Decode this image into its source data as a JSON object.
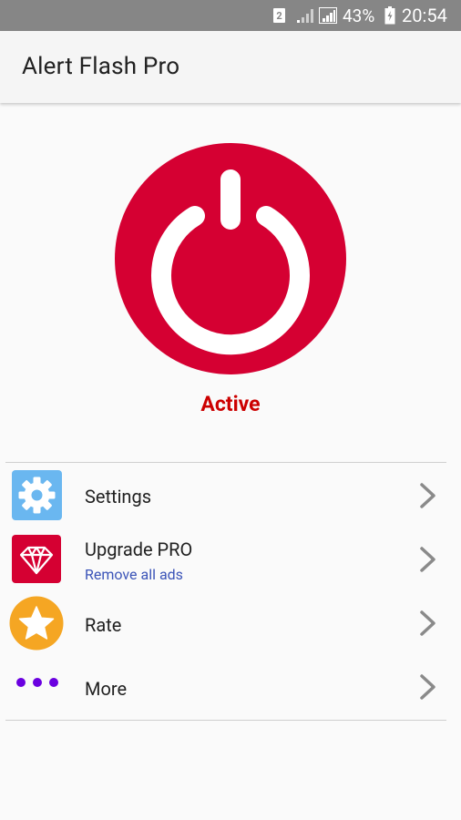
{
  "status_bar": {
    "sim_label": "2",
    "battery_percent": "43%",
    "time": "20:54"
  },
  "app_bar": {
    "title": "Alert Flash Pro"
  },
  "power": {
    "status": "Active",
    "color": "#d50032",
    "status_color": "#cc0000"
  },
  "menu": {
    "settings": {
      "label": "Settings",
      "icon": "gear-icon"
    },
    "upgrade": {
      "label": "Upgrade PRO",
      "sublabel": "Remove all ads",
      "icon": "diamond-icon"
    },
    "rate": {
      "label": "Rate",
      "icon": "star-icon"
    },
    "more": {
      "label": "More",
      "icon": "dots-icon"
    }
  },
  "colors": {
    "settings_icon_bg": "#6ab7f0",
    "upgrade_icon_bg": "#d50032",
    "rate_icon_bg": "#f5a623",
    "more_dots": "#6a00e0",
    "sublabel": "#3b54b8"
  }
}
